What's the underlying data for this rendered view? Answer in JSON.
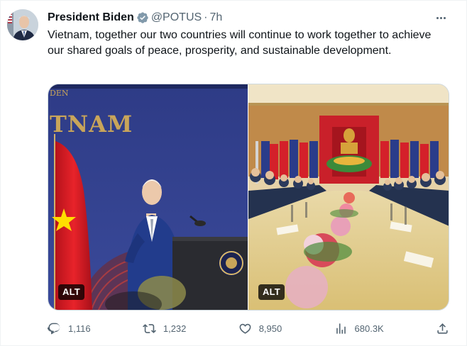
{
  "tweet": {
    "author_name": "President Biden",
    "handle": "@POTUS",
    "separator": "·",
    "time": "7h",
    "text": "Vietnam, together our two countries will continue to work together to achieve our shared goals of peace, prosperity, and sustainable development.",
    "verified_icon": "verified-badge-icon",
    "accent_color": "#1d9bf0"
  },
  "media": {
    "left": {
      "sign_text_top": "DEN",
      "sign_text_main": "TNAM",
      "alt_label": "ALT"
    },
    "right": {
      "alt_label": "ALT"
    }
  },
  "actions": {
    "replies": "1,116",
    "reposts": "1,232",
    "likes": "8,950",
    "views": "680.3K",
    "icons": [
      "reply-icon",
      "repost-icon",
      "like-icon",
      "views-icon",
      "share-icon"
    ]
  },
  "colors": {
    "text_primary": "#0f1419",
    "text_secondary": "#536471",
    "border": "#cfd9de"
  }
}
